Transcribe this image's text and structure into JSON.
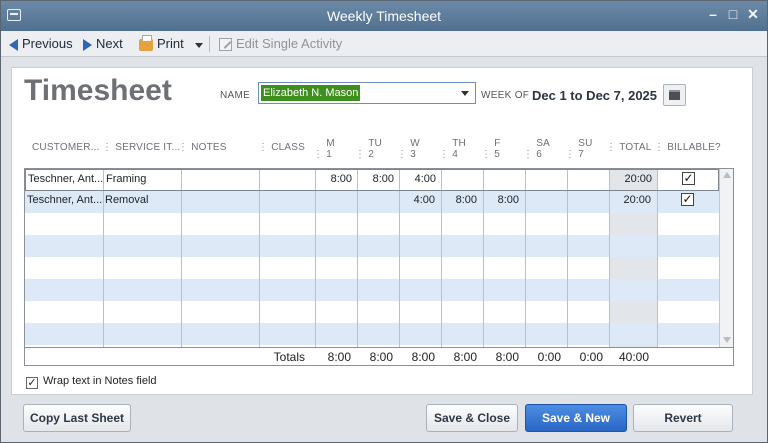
{
  "window": {
    "title": "Weekly Timesheet"
  },
  "toolbar": {
    "previous": "Previous",
    "next": "Next",
    "print": "Print",
    "edit_single_activity": "Edit Single Activity"
  },
  "form": {
    "heading": "Timesheet",
    "name_label": "NAME",
    "name_value": "Elizabeth N. Mason",
    "week_of_label": "WEEK OF",
    "week_of_value": "Dec 1 to Dec 7, 2025"
  },
  "columns": {
    "customer": "CUSTOMER...",
    "service_item": "SERVICE IT...",
    "notes": "NOTES",
    "class": "CLASS",
    "days": [
      {
        "day": "M",
        "num": "1"
      },
      {
        "day": "TU",
        "num": "2"
      },
      {
        "day": "W",
        "num": "3"
      },
      {
        "day": "TH",
        "num": "4"
      },
      {
        "day": "F",
        "num": "5"
      },
      {
        "day": "SA",
        "num": "6"
      },
      {
        "day": "SU",
        "num": "7"
      }
    ],
    "total": "TOTAL",
    "billable": "BILLABLE?"
  },
  "rows": [
    {
      "customer": "Teschner, Ant...",
      "service": "Framing",
      "notes": "",
      "class": "",
      "days": [
        "8:00",
        "8:00",
        "4:00",
        "",
        "",
        "",
        ""
      ],
      "total": "20:00",
      "billable": true
    },
    {
      "customer": "Teschner, Ant...",
      "service": "Removal",
      "notes": "",
      "class": "",
      "days": [
        "",
        "",
        "4:00",
        "8:00",
        "8:00",
        "",
        ""
      ],
      "total": "20:00",
      "billable": true
    }
  ],
  "totals": {
    "label": "Totals",
    "days": [
      "8:00",
      "8:00",
      "8:00",
      "8:00",
      "8:00",
      "0:00",
      "0:00"
    ],
    "grand_total": "40:00"
  },
  "wrap_notes": {
    "label": "Wrap text in Notes field",
    "checked": true
  },
  "buttons": {
    "copy_last_sheet": "Copy Last Sheet",
    "save_close": "Save & Close",
    "save_new": "Save & New",
    "revert": "Revert"
  },
  "colors": {
    "accent": "#2a66c4",
    "name_highlight": "#3f8f1f",
    "row_alt": "#dde9f7"
  }
}
